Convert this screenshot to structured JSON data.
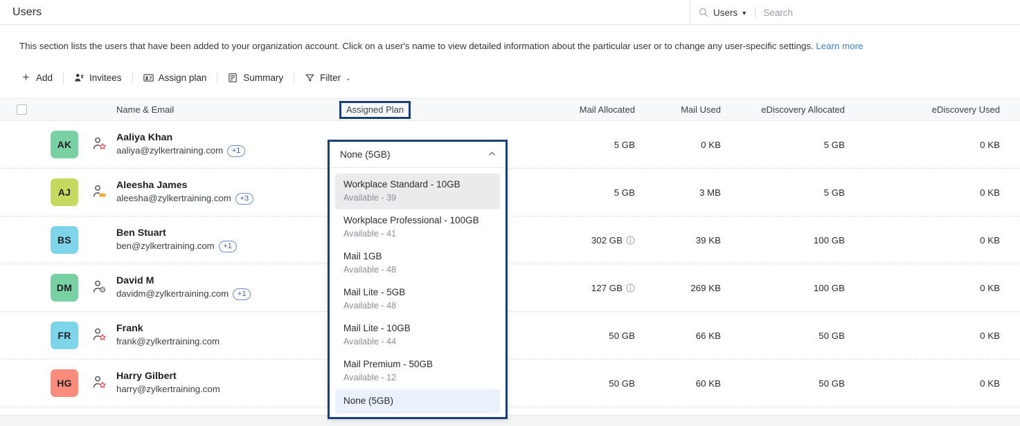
{
  "header": {
    "title": "Users",
    "search": {
      "icon": "search-icon",
      "scope_label": "Users",
      "caret": "▼",
      "placeholder": "Search",
      "value": ""
    }
  },
  "description": {
    "text": "This section lists the users that have been added to your organization account. Click on a user's name to view detailed information about the particular user or to change any user-specific settings. ",
    "link_label": "Learn more",
    "link_color": "#3f7fd6"
  },
  "toolbar": {
    "items": [
      {
        "label": "Add",
        "icon": "plus-icon"
      },
      {
        "label": "Invitees",
        "icon": "invitees-icon"
      },
      {
        "label": "Assign plan",
        "icon": "assign-plan-icon"
      },
      {
        "label": "Summary",
        "icon": "summary-icon"
      },
      {
        "label": "Filter",
        "icon": "filter-icon",
        "caret": "⌄"
      }
    ]
  },
  "table": {
    "columns": {
      "select_all": "",
      "name_email": "Name & Email",
      "assigned_plan": "Assigned Plan",
      "mail_allocated": "Mail Allocated",
      "mail_used": "Mail Used",
      "ediscovery_allocated": "eDiscovery Allocated",
      "ediscovery_used": "eDiscovery Used"
    },
    "highlight_color": "#1c3f73",
    "rows": [
      {
        "initials": "AK",
        "avatar_color": "#79d1a3",
        "role_icon": "user-star-icon",
        "role_icon_color": "#e8555a",
        "name": "Aaliya Khan",
        "email": "aaliya@zylkertraining.com",
        "extra_emails": "+1",
        "assigned_plan": "",
        "mail_allocated": "5 GB",
        "mail_allocated_info": false,
        "mail_used": "0 KB",
        "ediscovery_allocated": "5 GB",
        "ediscovery_used": "0 KB"
      },
      {
        "initials": "AJ",
        "avatar_color": "#c3d960",
        "role_icon": "user-crown-icon",
        "role_icon_color": "#f0a32b",
        "name": "Aleesha James",
        "email": "aleesha@zylkertraining.com",
        "extra_emails": "+3",
        "assigned_plan": "",
        "mail_allocated": "5 GB",
        "mail_allocated_info": false,
        "mail_used": "3 MB",
        "ediscovery_allocated": "5 GB",
        "ediscovery_used": "0 KB"
      },
      {
        "initials": "BS",
        "avatar_color": "#7ed4e8",
        "role_icon": "",
        "role_icon_color": "",
        "name": "Ben Stuart",
        "email": "ben@zylkertraining.com",
        "extra_emails": "+1",
        "assigned_plan": "",
        "mail_allocated": "302 GB",
        "mail_allocated_info": true,
        "mail_used": "39 KB",
        "ediscovery_allocated": "100 GB",
        "ediscovery_used": "0 KB"
      },
      {
        "initials": "DM",
        "avatar_color": "#79d1a3",
        "role_icon": "user-gear-icon",
        "role_icon_color": "#6b7075",
        "name": "David M",
        "email": "davidm@zylkertraining.com",
        "extra_emails": "+1",
        "assigned_plan": "",
        "mail_allocated": "127 GB",
        "mail_allocated_info": true,
        "mail_used": "269 KB",
        "ediscovery_allocated": "100 GB",
        "ediscovery_used": "0 KB"
      },
      {
        "initials": "FR",
        "avatar_color": "#7ed4e8",
        "role_icon": "user-star-icon",
        "role_icon_color": "#e8555a",
        "name": "Frank",
        "email": "frank@zylkertraining.com",
        "extra_emails": "",
        "assigned_plan": "",
        "mail_allocated": "50 GB",
        "mail_allocated_info": false,
        "mail_used": "66 KB",
        "ediscovery_allocated": "50 GB",
        "ediscovery_used": "0 KB"
      },
      {
        "initials": "HG",
        "avatar_color": "#f98c7d",
        "role_icon": "user-star-icon",
        "role_icon_color": "#e8555a",
        "name": "Harry Gilbert",
        "email": "harry@zylkertraining.com",
        "extra_emails": "",
        "assigned_plan": "",
        "mail_allocated": "50 GB",
        "mail_allocated_info": false,
        "mail_used": "60 KB",
        "ediscovery_allocated": "50 GB",
        "ediscovery_used": "0 KB"
      }
    ]
  },
  "plan_dropdown": {
    "selected_value": "None (5GB)",
    "chevron": "⌃",
    "options": [
      {
        "title": "Workplace Standard - 10GB",
        "available": "Available - 39",
        "state": "hover"
      },
      {
        "title": "Workplace Professional - 100GB",
        "available": "Available - 41",
        "state": ""
      },
      {
        "title": "Mail 1GB",
        "available": "Available - 48",
        "state": ""
      },
      {
        "title": "Mail Lite - 5GB",
        "available": "Available - 48",
        "state": ""
      },
      {
        "title": "Mail Lite - 10GB",
        "available": "Available - 44",
        "state": ""
      },
      {
        "title": "Mail Premium - 50GB",
        "available": "Available - 12",
        "state": ""
      },
      {
        "title": "None (5GB)",
        "available": "",
        "state": "selected"
      }
    ]
  }
}
